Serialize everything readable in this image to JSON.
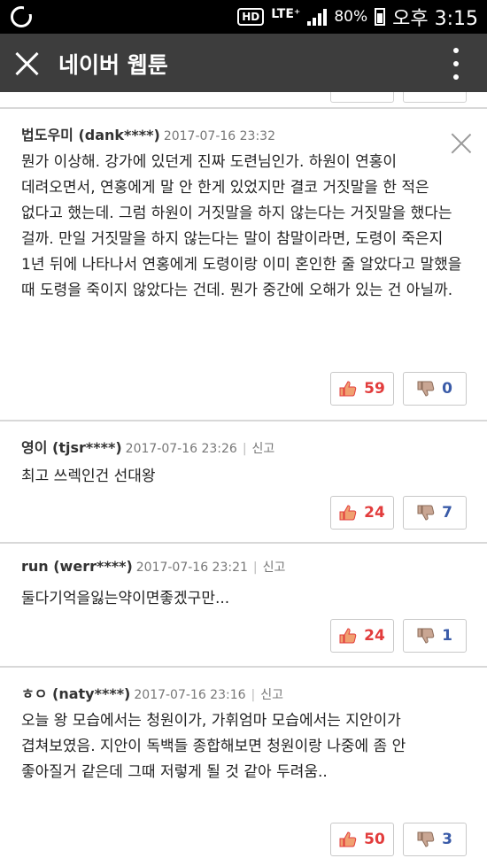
{
  "status_bar": {
    "hd": "HD",
    "network": "LTE⁺",
    "battery": "80%",
    "time": "오후 3:15"
  },
  "app_bar": {
    "title": "네이버 웹툰"
  },
  "comments": [
    {
      "nick": "법도우미 (dank****)",
      "date": "2017-07-16 23:32",
      "body": "뭔가 이상해. 강가에 있던게 진짜 도련님인가. 하원이 연홍이 데려오면서, 연홍에게 말 안 한게 있었지만 결코 거짓말을 한 적은 없다고 했는데. 그럼 하원이 거짓말을 하지 않는다는 거짓말을 했다는 걸까. 만일 거짓말을 하지 않는다는 말이 참말이라면, 도령이 죽은지 1년 뒤에 나타나서 연홍에게 도령이랑 이미 혼인한 줄 알았다고 말했을 때 도령을 죽이지 않았다는 건데. 뭔가 중간에 오해가 있는 건 아닐까.",
      "likes": "59",
      "dislikes": "0"
    },
    {
      "nick": "영이 (tjsr****)",
      "date": "2017-07-16 23:26",
      "report": "신고",
      "body": "최고 쓰렉인건 선대왕",
      "likes": "24",
      "dislikes": "7"
    },
    {
      "nick": "run (werr****)",
      "date": "2017-07-16 23:21",
      "report": "신고",
      "body": "둘다기억을잃는약이면좋겠구만...",
      "likes": "24",
      "dislikes": "1"
    },
    {
      "nick": "ㅎㅇ (naty****)",
      "date": "2017-07-16 23:16",
      "report": "신고",
      "body": "오늘 왕 모습에서는 청원이가, 가휘엄마 모습에서는 지안이가 겹쳐보였음. 지안이 독백들 종합해보면 청원이랑 나중에 좀 안 좋아질거 같은데 그때 저렇게 될 것 같아 두려움..",
      "likes": "50",
      "dislikes": "3"
    }
  ],
  "colors": {
    "like": "#e23c3c",
    "dislike": "#3a5ba8",
    "app_bar": "#3d3d3d"
  }
}
